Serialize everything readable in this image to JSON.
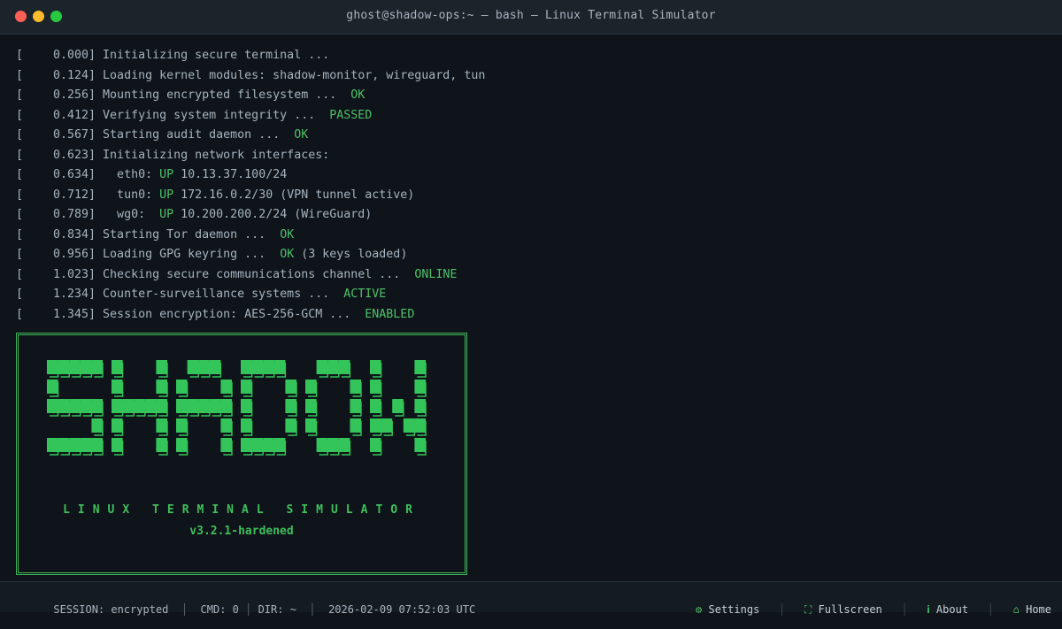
{
  "window": {
    "title": "ghost@shadow-ops:~ — bash — Linux Terminal Simulator"
  },
  "boot_log": [
    {
      "ts": "0.000",
      "msg": "Initializing secure terminal",
      "dots": "...",
      "status": "",
      "after": ""
    },
    {
      "ts": "0.124",
      "msg": "Loading kernel modules: shadow-monitor, wireguard, tun",
      "dots": "",
      "status": "",
      "after": ""
    },
    {
      "ts": "0.256",
      "msg": "Mounting encrypted filesystem",
      "dots": "...",
      "status": "OK",
      "after": ""
    },
    {
      "ts": "0.412",
      "msg": "Verifying system integrity",
      "dots": "...",
      "status": "PASSED",
      "after": ""
    },
    {
      "ts": "0.567",
      "msg": "Starting audit daemon",
      "dots": "...",
      "status": "OK",
      "after": ""
    },
    {
      "ts": "0.623",
      "msg": "Initializing network interfaces:",
      "dots": "",
      "status": "",
      "after": ""
    },
    {
      "ts": "0.634",
      "msg": "  eth0:",
      "dots": "",
      "status": "UP",
      "after": " 10.13.37.100/24"
    },
    {
      "ts": "0.712",
      "msg": "  tun0:",
      "dots": "",
      "status": "UP",
      "after": " 172.16.0.2/30 (VPN tunnel active)"
    },
    {
      "ts": "0.789",
      "msg": "  wg0: ",
      "dots": "",
      "status": "UP",
      "after": " 10.200.200.2/24 (WireGuard)"
    },
    {
      "ts": "0.834",
      "msg": "Starting Tor daemon",
      "dots": "...",
      "status": "OK",
      "after": ""
    },
    {
      "ts": "0.956",
      "msg": "Loading GPG keyring",
      "dots": "...",
      "status": "OK",
      "after": " (3 keys loaded)"
    },
    {
      "ts": "1.023",
      "msg": "Checking secure communications channel",
      "dots": "...",
      "status": "ONLINE",
      "after": ""
    },
    {
      "ts": "1.234",
      "msg": "Counter-surveillance systems",
      "dots": "...",
      "status": "ACTIVE",
      "after": ""
    },
    {
      "ts": "1.345",
      "msg": "Session encryption: AES-256-GCM",
      "dots": "...",
      "status": "ENABLED",
      "after": ""
    }
  ],
  "banner": {
    "logo_text": "SHADOW",
    "subtitle": "LINUX TERMINAL SIMULATOR",
    "version": "v3.2.1-hardened"
  },
  "statusbar": {
    "session": "SESSION: encrypted",
    "cmd": "CMD: 0",
    "dir": "DIR: ~",
    "datetime": "2026-02-09 07:52:03 UTC",
    "settings": "Settings",
    "fullscreen": "Fullscreen",
    "about": "About",
    "home": "Home"
  },
  "colors": {
    "accent": "#4ec16a",
    "background": "#0e1419",
    "text": "#a6b3bf"
  }
}
